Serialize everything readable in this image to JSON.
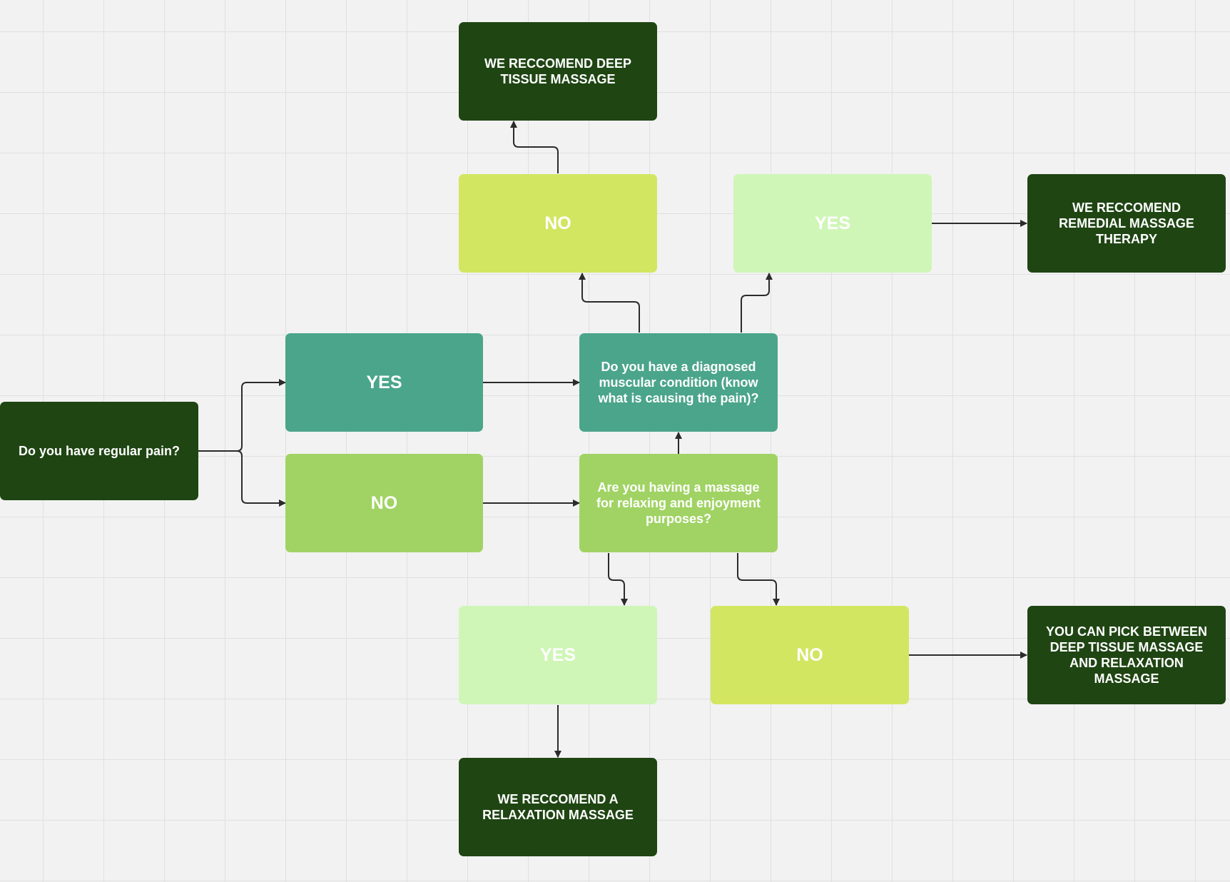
{
  "nodes": {
    "start": "Do you have regular pain?",
    "yes_pain": "YES",
    "no_pain": "NO",
    "q_diagnosed": "Do you have a diagnosed muscular condition (know what is causing the pain)?",
    "q_relaxing": "Are you having a massage for relaxing and enjoyment purposes?",
    "no_diagnosed": "NO",
    "yes_diagnosed": "YES",
    "rec_deep_tissue": "WE RECCOMEND DEEP TISSUE MASSAGE",
    "rec_remedial": "WE RECCOMEND REMEDIAL MASSAGE THERAPY",
    "yes_relaxing": "YES",
    "no_relaxing": "NO",
    "rec_relaxation": "WE RECCOMEND A RELAXATION MASSAGE",
    "rec_pick_between": "YOU CAN PICK BETWEEN DEEP TISSUE MASSAGE AND RELAXATION MASSAGE"
  },
  "colors": {
    "dark_green": "#1f4513",
    "teal": "#4ba58a",
    "light_green": "#a0d364",
    "lime": "#d3e662",
    "mint": "#cff6b7",
    "connector": "#2b2b2b",
    "grid": "#e0e0e0",
    "canvas": "#f2f2f2"
  }
}
